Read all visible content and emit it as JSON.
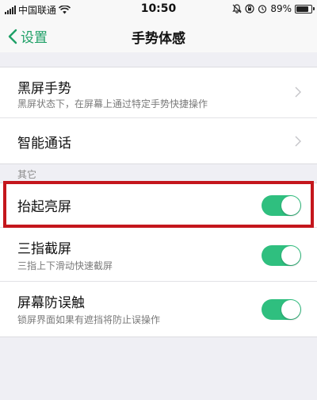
{
  "status_bar": {
    "carrier": "中国联通",
    "time": "10:50",
    "battery_percent": "89%",
    "battery_level": 0.89
  },
  "nav": {
    "back_label": "设置",
    "title": "手势体感"
  },
  "group1": {
    "items": [
      {
        "title": "黑屏手势",
        "subtitle": "黑屏状态下，在屏幕上通过特定手势快捷操作"
      },
      {
        "title": "智能通话"
      }
    ]
  },
  "section_other": "其它",
  "group2": {
    "items": [
      {
        "title": "抬起亮屏",
        "enabled": true
      },
      {
        "title": "三指截屏",
        "subtitle": "三指上下滑动快速截屏",
        "enabled": true
      },
      {
        "title": "屏幕防误触",
        "subtitle": "锁屏界面如果有遮挡将防止误操作",
        "enabled": true
      }
    ]
  },
  "colors": {
    "accent": "#1fa067",
    "toggle_on": "#2fbf7f",
    "highlight": "#c4161c"
  }
}
